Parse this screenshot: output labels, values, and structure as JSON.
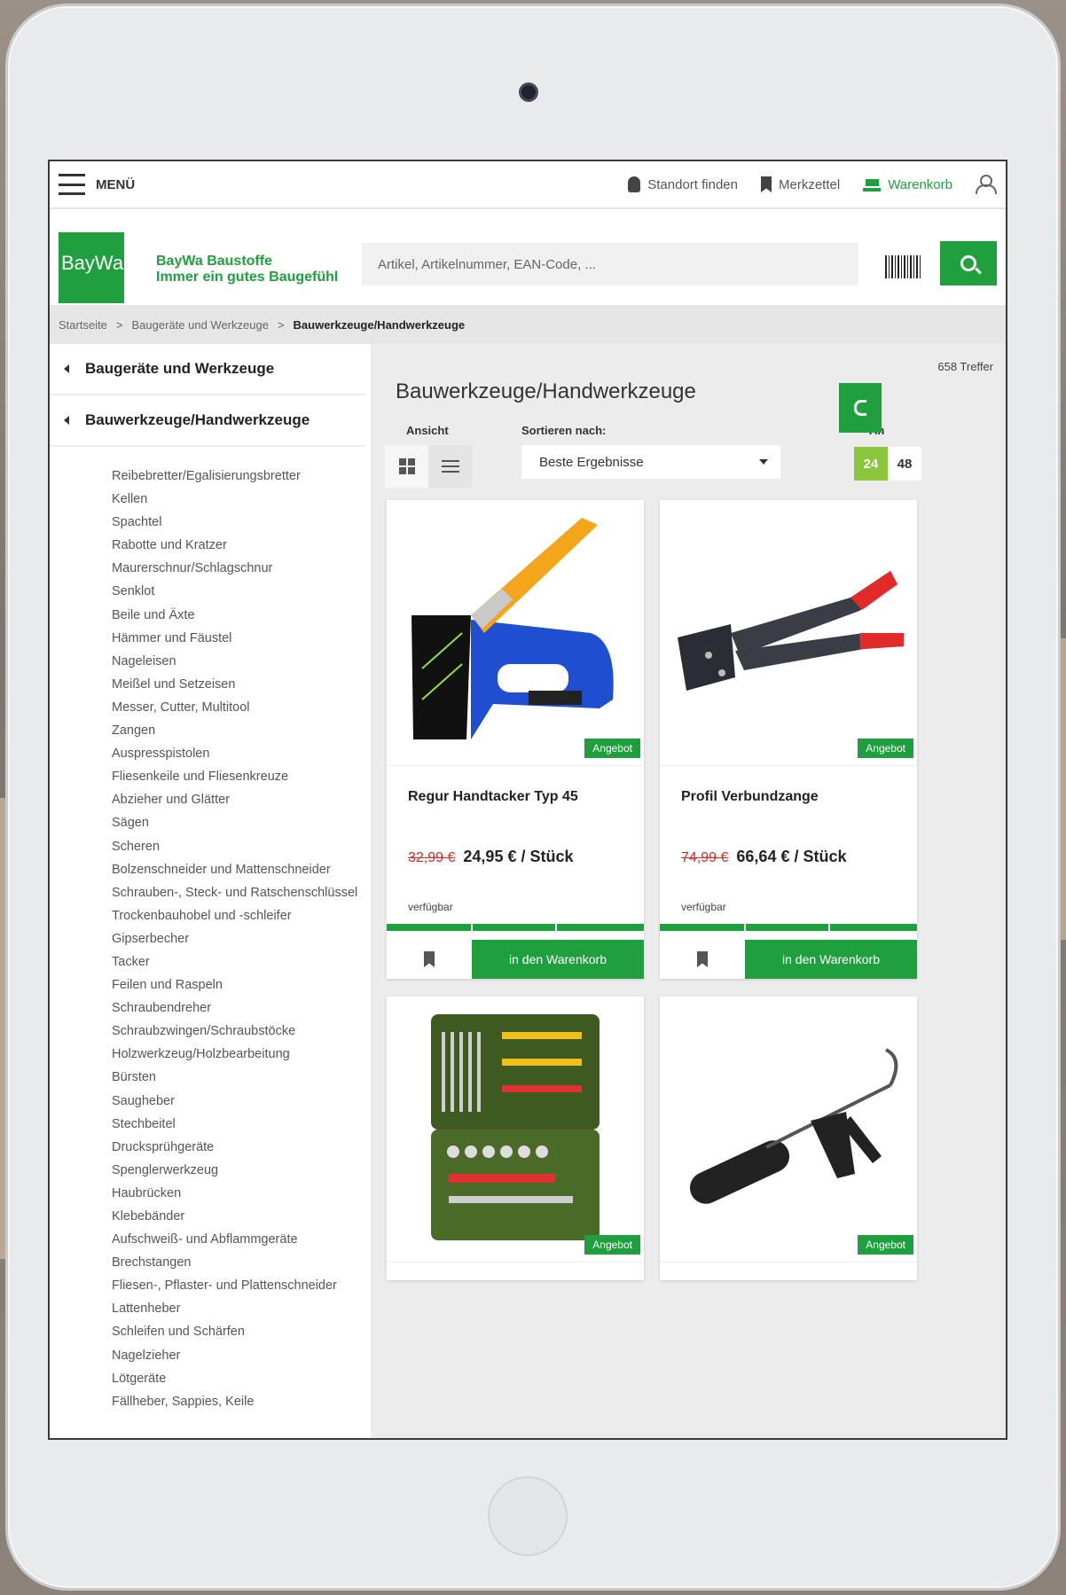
{
  "topbar": {
    "menu_label": "MENÜ",
    "store_label": "Standort finden",
    "wishlist_label": "Merkzettel",
    "cart_label": "Warenkorb"
  },
  "header": {
    "logo_text": "BayWa",
    "tagline_line1": "BayWa Baustoffe",
    "tagline_line2": "Immer ein gutes Baugefühl",
    "search_placeholder": "Artikel, Artikelnummer, EAN-Code, ..."
  },
  "breadcrumb": {
    "items": [
      "Startseite",
      "Baugeräte und Werkzeuge",
      "Bauwerkzeuge/Handwerkzeuge"
    ],
    "separator": ">"
  },
  "sidebar": {
    "parent": "Baugeräte und Werkzeuge",
    "current": "Bauwerkzeuge/Handwerkzeuge",
    "items": [
      "Reibebretter/Egalisierungsbretter",
      "Kellen",
      "Spachtel",
      "Rabotte und Kratzer",
      "Maurerschnur/Schlagschnur",
      "Senklot",
      "Beile und Äxte",
      "Hämmer und Fäustel",
      "Nageleisen",
      "Meißel und Setzeisen",
      "Messer, Cutter, Multitool",
      "Zangen",
      "Auspresspistolen",
      "Fliesenkeile und Fliesenkreuze",
      "Abzieher und Glätter",
      "Sägen",
      "Scheren",
      "Bolzenschneider und Mattenschneider",
      "Schrauben-, Steck- und Ratschenschlüssel",
      "Trockenbauhobel und -schleifer",
      "Gipserbecher",
      "Tacker",
      "Feilen und Raspeln",
      "Schraubendreher",
      "Schraubzwingen/Schraubstöcke",
      "Holzwerkzeug/Holzbearbeitung",
      "Bürsten",
      "Saugheber",
      "Stechbeitel",
      "Drucksprühgeräte",
      "Spenglerwerkzeug",
      "Haubrücken",
      "Klebebänder",
      "Aufschweiß- und Abflammgeräte",
      "Brechstangen",
      "Fliesen-, Pflaster- und Plattenschneider",
      "Lattenheber",
      "Schleifen und Schärfen",
      "Nagelzieher",
      "Lötgeräte",
      "Fällheber, Sappies, Keile"
    ]
  },
  "main": {
    "hits": "658 Treffer",
    "title": "Bauwerkzeuge/Handwerkzeuge",
    "view_label": "Ansicht",
    "sort_label": "Sortieren nach:",
    "sort_value": "Beste Ergebnisse",
    "per_page_label": "An",
    "per_page_options": [
      "24",
      "48"
    ]
  },
  "products": [
    {
      "name": "Regur Handtacker Typ 45",
      "old_price": "32,99 €",
      "price": "24,95 € / Stück",
      "availability": "verfügbar",
      "badge": "Angebot",
      "cart_label": "in den Warenkorb"
    },
    {
      "name": "Profil Verbundzange",
      "old_price": "74,99 €",
      "price": "66,64 € / Stück",
      "availability": "verfügbar",
      "badge": "Angebot",
      "cart_label": "in den Warenkorb"
    },
    {
      "badge": "Angebot"
    },
    {
      "badge": "Angebot"
    }
  ],
  "colors": {
    "brand": "#1f9f3d",
    "per_page_active": "#8cc63f",
    "old_price": "#d02b2b"
  }
}
